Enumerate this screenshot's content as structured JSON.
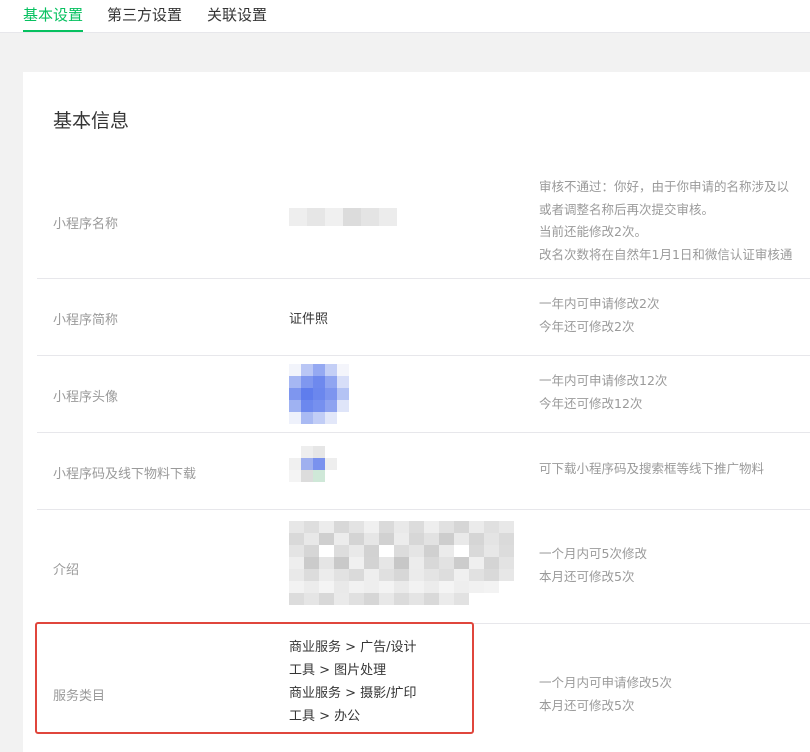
{
  "tabs": [
    "基本设置",
    "第三方设置",
    "关联设置"
  ],
  "section_title": "基本信息",
  "rows": {
    "name": {
      "label": "小程序名称",
      "tips": [
        "审核不通过：你好，由于你申请的名称涉及以",
        "或者调整名称后再次提交审核。",
        "当前还能修改2次。",
        "改名次数将在自然年1月1日和微信认证审核通"
      ]
    },
    "short_name": {
      "label": "小程序简称",
      "value": "证件照",
      "tips": [
        "一年内可申请修改2次",
        "今年还可修改2次"
      ]
    },
    "avatar": {
      "label": "小程序头像",
      "tips": [
        "一年内可申请修改12次",
        "今年还可修改12次"
      ]
    },
    "qrcode": {
      "label": "小程序码及线下物料下载",
      "tips": [
        "可下载小程序码及搜索框等线下推广物料"
      ]
    },
    "intro": {
      "label": "介绍",
      "tips": [
        "一个月内可5次修改",
        "本月还可修改5次"
      ]
    },
    "category": {
      "label": "服务类目",
      "items": [
        "商业服务 > 广告/设计",
        "工具 > 图片处理",
        "商业服务 > 摄影/扩印",
        "工具 > 办公"
      ],
      "tips": [
        "一个月内可申请修改5次",
        "本月还可修改5次"
      ]
    }
  },
  "colors": {
    "accent": "#07c160",
    "highlight_border": "#e0463c",
    "muted_text": "#9a9a9a",
    "divider": "#e7e7eb"
  }
}
